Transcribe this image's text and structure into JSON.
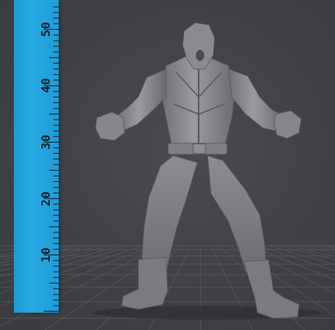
{
  "viewport": {
    "background": "#404144",
    "grid_color": "#5a5b5f"
  },
  "ruler": {
    "color": "#27aae3",
    "tick_color": "#13222e",
    "unit_labels": [
      "10",
      "20",
      "30",
      "40",
      "50"
    ]
  },
  "model": {
    "subject": "figure-miniature",
    "color": "#8d8e92"
  }
}
